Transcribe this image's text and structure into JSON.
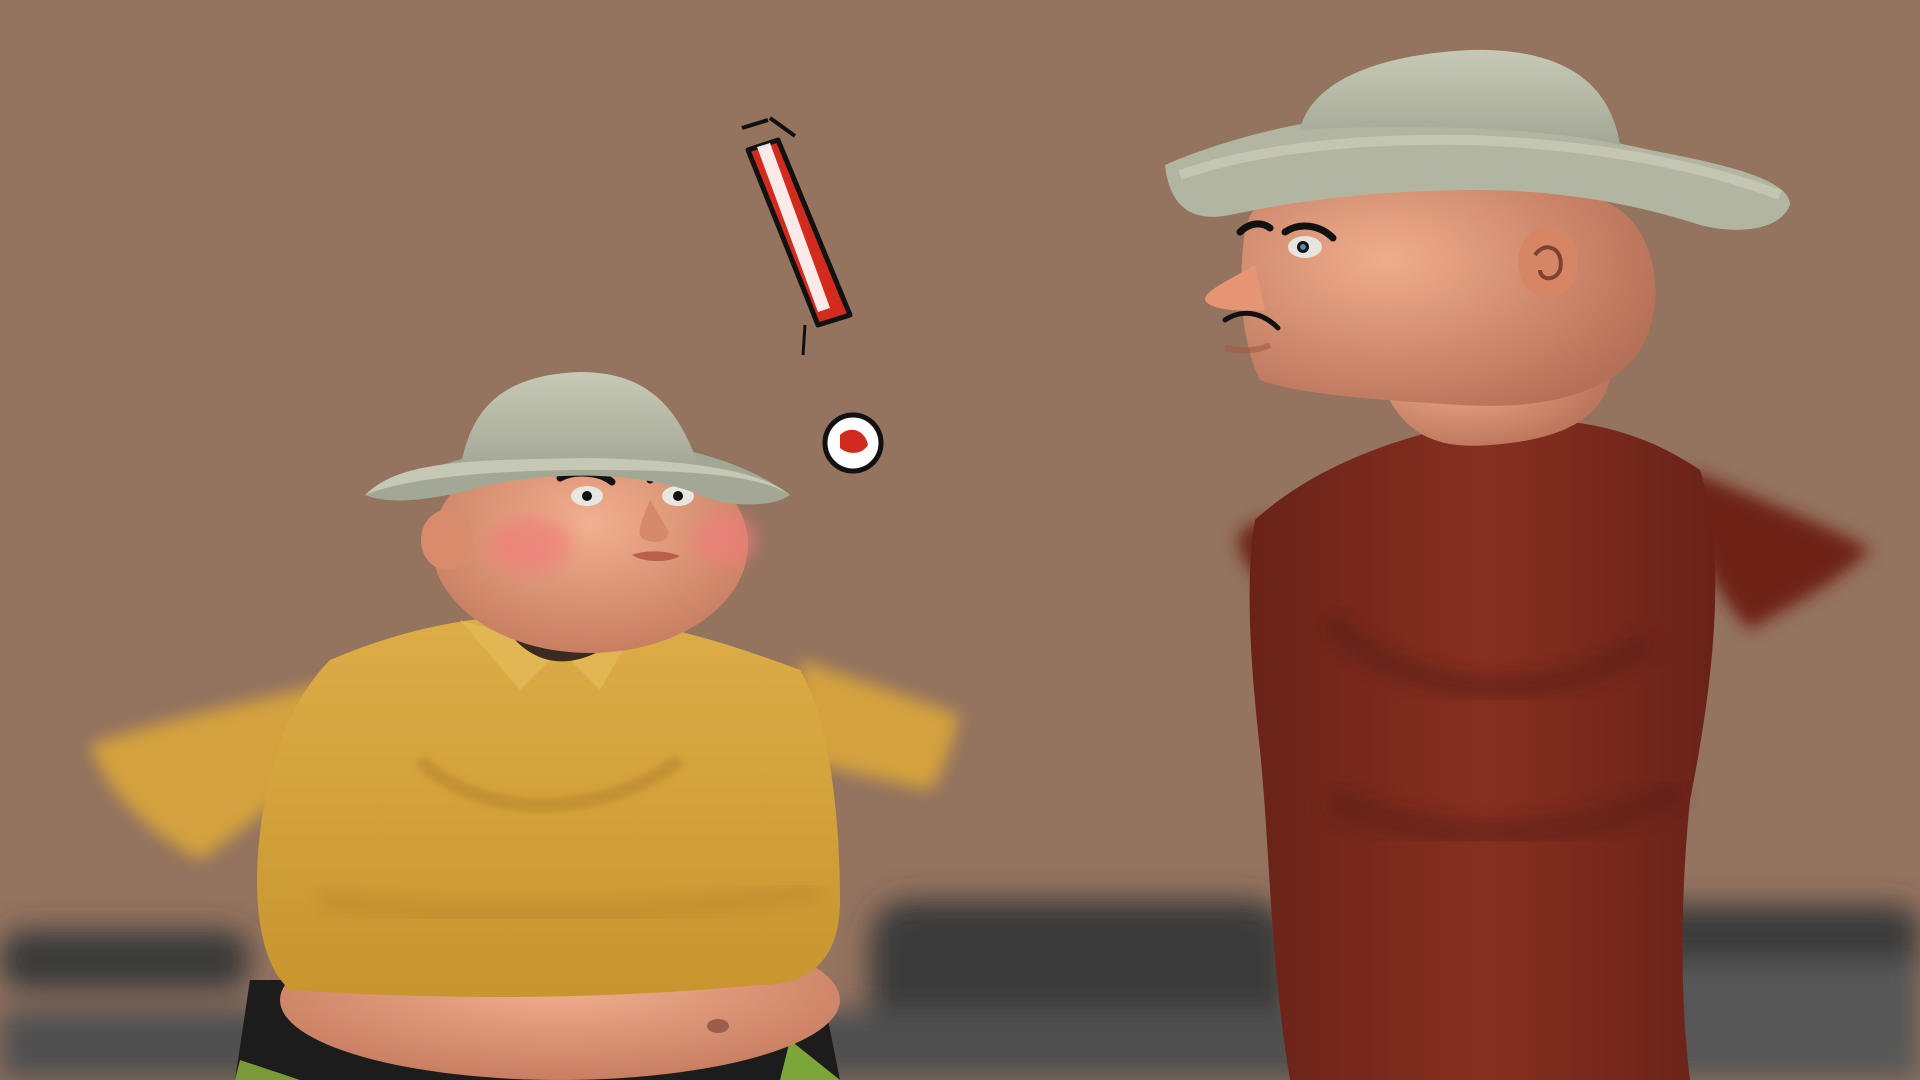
{
  "scene": {
    "description_free": true,
    "palette": {
      "background": "#94735f",
      "background_dark": "#8a6a58",
      "ground_shadow": "#3a3a3a",
      "hat": "#bcbfab",
      "hat_shadow": "#8f9484",
      "skin": "#eaa07e",
      "skin_shadow": "#c97e62",
      "cheek": "#f07d7a",
      "yellow_shirt": "#d9a83f",
      "yellow_shirt_shadow": "#b2822a",
      "red_shirt": "#7a2a1e",
      "red_shirt_shadow": "#5a1c14",
      "exclamation_red": "#d22a1c",
      "ink": "#111111"
    },
    "figures": [
      {
        "name": "short-man",
        "shirt": "yellow",
        "expression": "surprised"
      },
      {
        "name": "tall-man",
        "shirt": "red",
        "expression": "frowning"
      }
    ],
    "symbol": {
      "name": "exclamation-mark"
    }
  }
}
